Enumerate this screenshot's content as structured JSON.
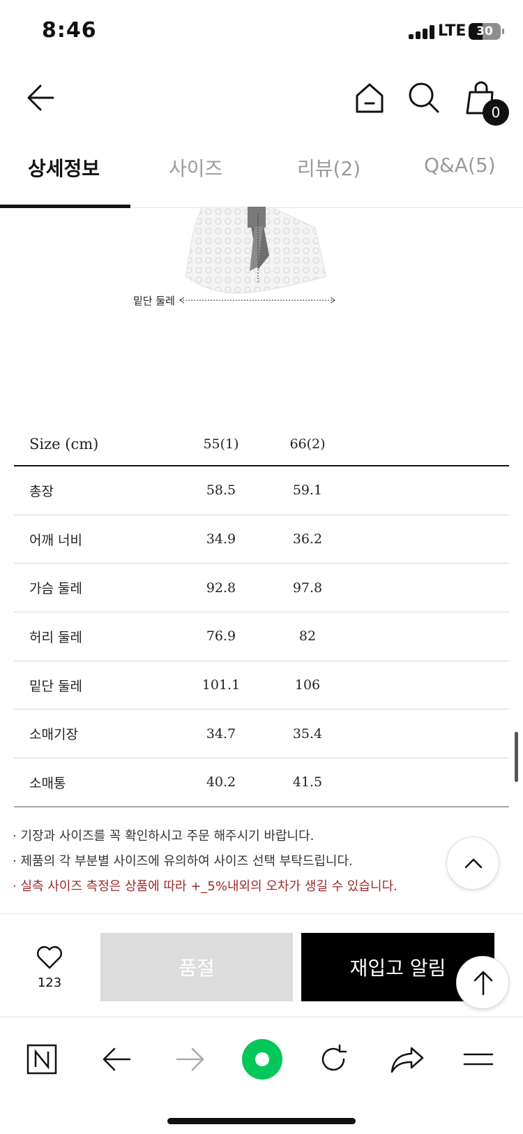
{
  "status": {
    "time": "8:46",
    "network": "LTE",
    "battery": "30"
  },
  "nav": {
    "cart_count": "0"
  },
  "tabs": [
    {
      "label": "상세정보",
      "active": true
    },
    {
      "label": "사이즈",
      "active": false
    },
    {
      "label": "리뷰(2)",
      "active": false
    },
    {
      "label": "Q&A(5)",
      "active": false
    }
  ],
  "image": {
    "hem_label": "밑단 둘레"
  },
  "size_table": {
    "headers": [
      "Size (cm)",
      "55(1)",
      "66(2)"
    ],
    "rows": [
      {
        "label": "총장",
        "v1": "58.5",
        "v2": "59.1"
      },
      {
        "label": "어깨 너비",
        "v1": "34.9",
        "v2": "36.2"
      },
      {
        "label": "가슴 둘레",
        "v1": "92.8",
        "v2": "97.8"
      },
      {
        "label": "허리 둘레",
        "v1": "76.9",
        "v2": "82"
      },
      {
        "label": "밑단 둘레",
        "v1": "101.1",
        "v2": "106"
      },
      {
        "label": "소매기장",
        "v1": "34.7",
        "v2": "35.4"
      },
      {
        "label": "소매통",
        "v1": "40.2",
        "v2": "41.5"
      }
    ]
  },
  "notes": [
    "· 기장과 사이즈를 꼭 확인하시고 주문 해주시기 바랍니다.",
    "· 제품의 각 부분별 사이즈에 유의하여 사이즈 선택 부탁드립니다.",
    "· 실측 사이즈 측정은 상품에 따라 +_5%내외의 오차가 생길 수 있습니다."
  ],
  "purchase": {
    "like_count": "123",
    "soldout_label": "품절",
    "restock_label": "재입고 알림"
  },
  "colors": {
    "accent_green": "#03c75a",
    "warning_red": "#9b2a2a",
    "soldout_gray": "#dcdcdc"
  }
}
